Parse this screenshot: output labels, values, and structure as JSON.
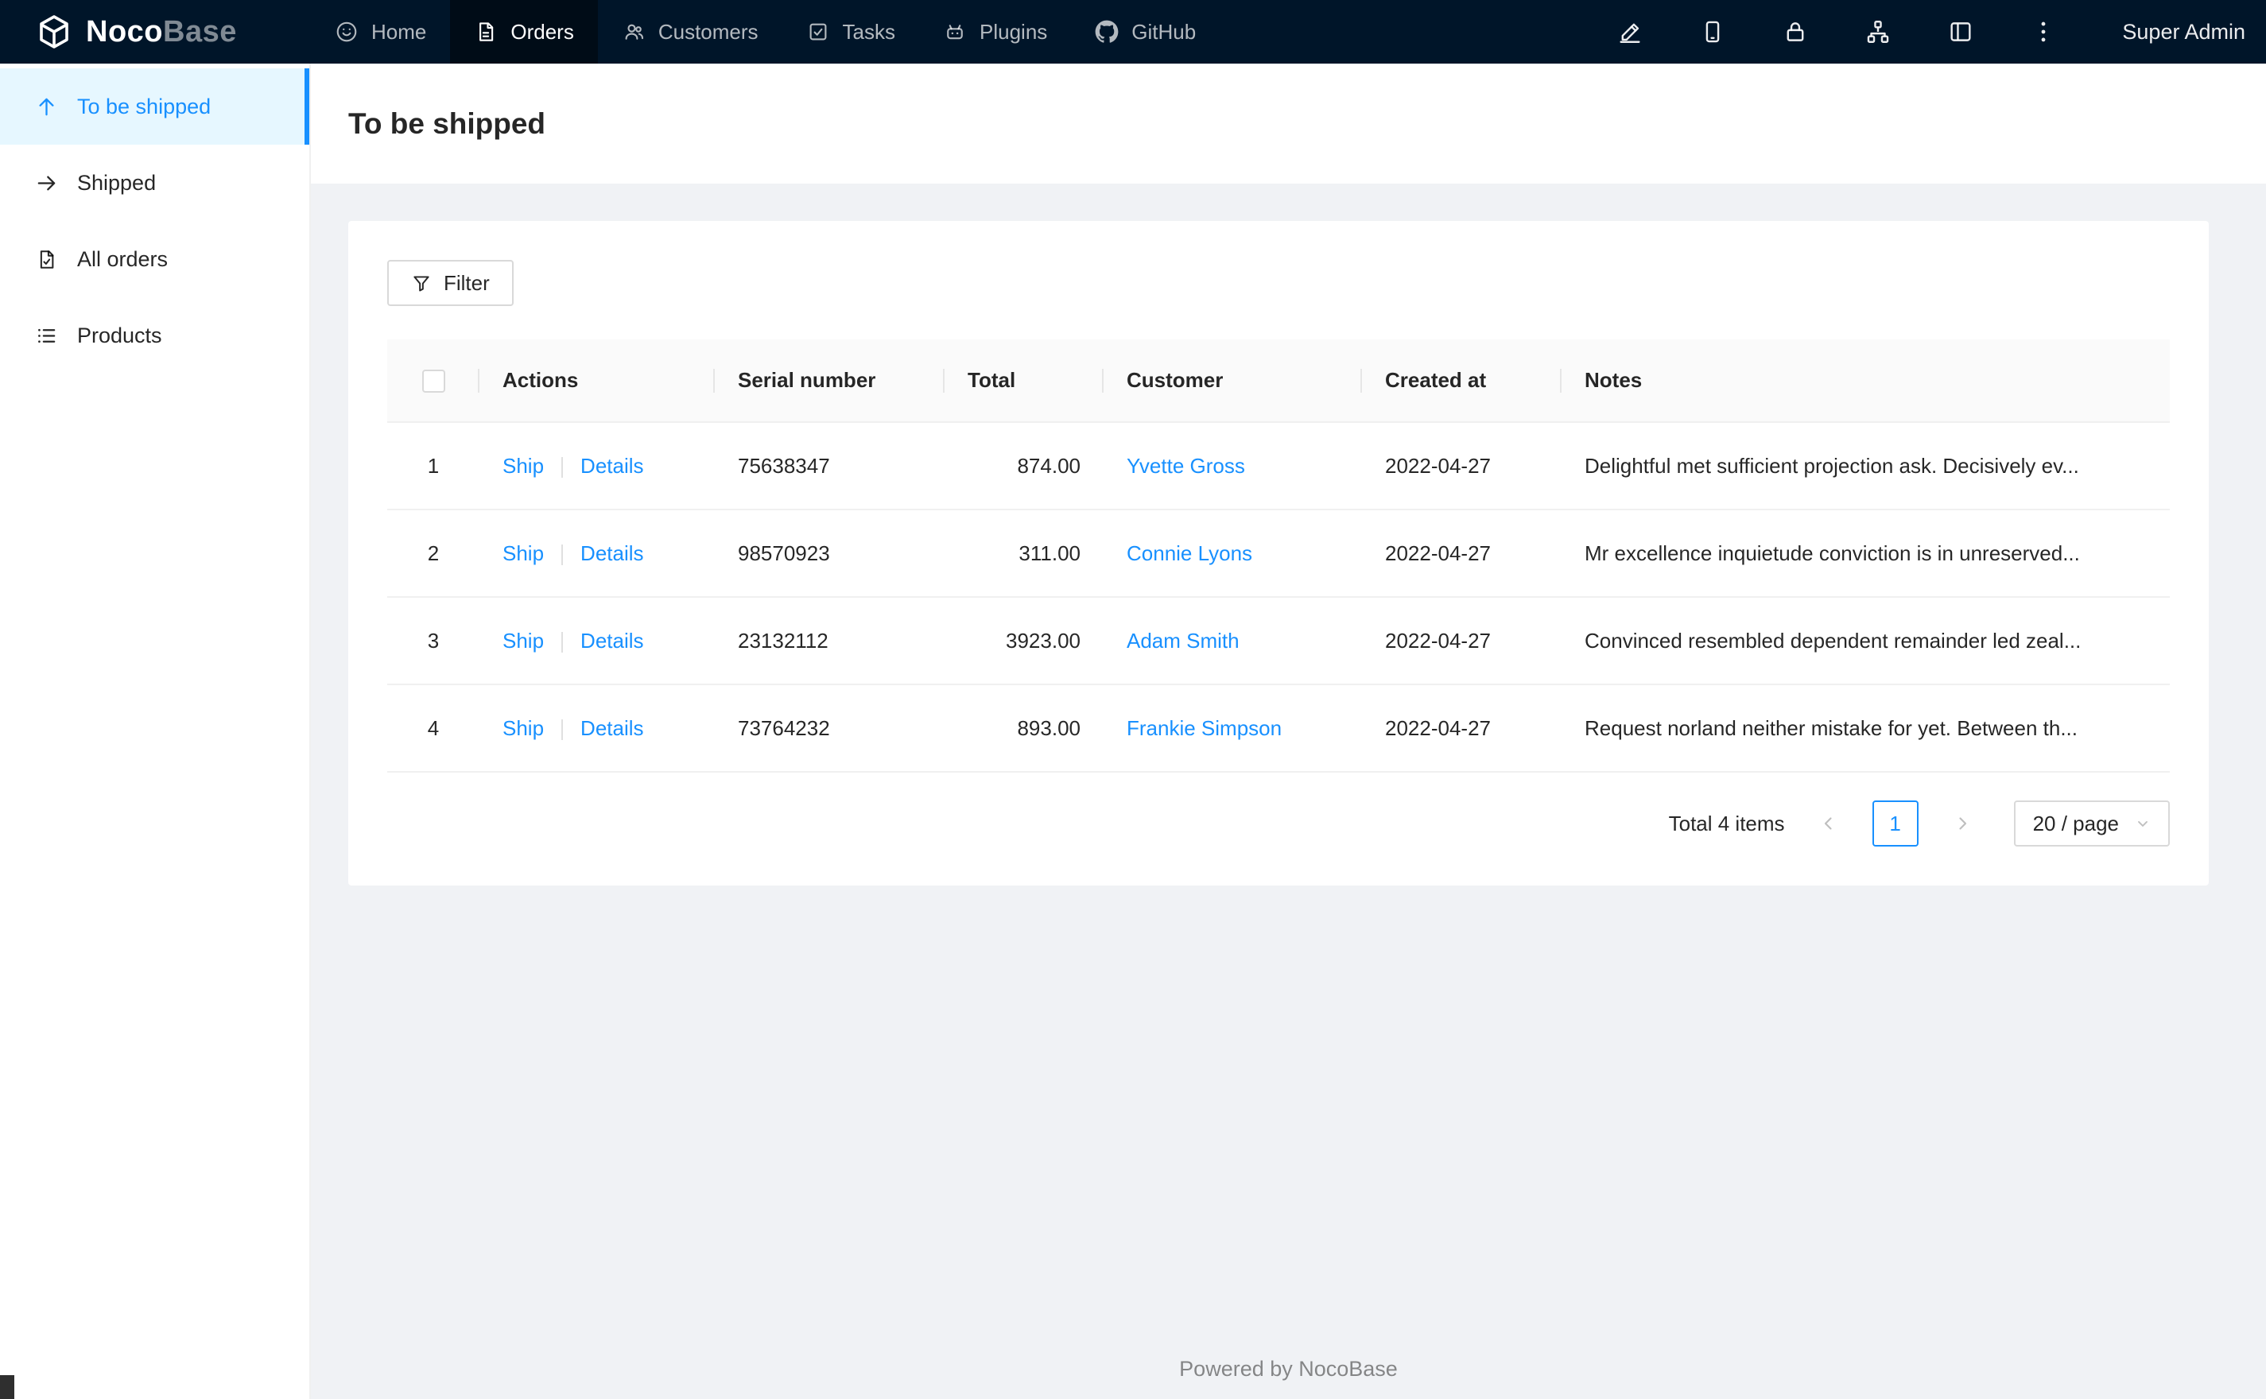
{
  "colors": {
    "accent": "#1890ff",
    "topbar_bg": "#001529",
    "selected_bg": "#e6f7ff"
  },
  "topbar": {
    "logo": {
      "noco": "Noco",
      "base": "Base"
    },
    "nav": [
      {
        "label": "Home"
      },
      {
        "label": "Orders"
      },
      {
        "label": "Customers"
      },
      {
        "label": "Tasks"
      },
      {
        "label": "Plugins"
      },
      {
        "label": "GitHub"
      }
    ],
    "user": "Super Admin"
  },
  "sidebar": {
    "items": [
      {
        "label": "To be shipped"
      },
      {
        "label": "Shipped"
      },
      {
        "label": "All orders"
      },
      {
        "label": "Products"
      }
    ]
  },
  "page": {
    "title": "To be shipped"
  },
  "toolbar": {
    "filter_label": "Filter"
  },
  "table": {
    "columns": {
      "actions": "Actions",
      "serial": "Serial number",
      "total": "Total",
      "customer": "Customer",
      "created": "Created at",
      "notes": "Notes"
    },
    "action_labels": {
      "ship": "Ship",
      "details": "Details"
    },
    "rows": [
      {
        "index": "1",
        "serial": "75638347",
        "total": "874.00",
        "customer": "Yvette Gross",
        "created": "2022-04-27",
        "notes": "Delightful met sufficient projection ask. Decisively ev..."
      },
      {
        "index": "2",
        "serial": "98570923",
        "total": "311.00",
        "customer": "Connie Lyons",
        "created": "2022-04-27",
        "notes": "Mr excellence inquietude conviction is in unreserved..."
      },
      {
        "index": "3",
        "serial": "23132112",
        "total": "3923.00",
        "customer": "Adam Smith",
        "created": "2022-04-27",
        "notes": "Convinced resembled dependent remainder led zeal..."
      },
      {
        "index": "4",
        "serial": "73764232",
        "total": "893.00",
        "customer": "Frankie Simpson",
        "created": "2022-04-27",
        "notes": "Request norland neither mistake for yet. Between th..."
      }
    ]
  },
  "pagination": {
    "total_text": "Total 4 items",
    "current_page": "1",
    "page_size": "20 / page"
  },
  "footer": {
    "text": "Powered by NocoBase"
  }
}
